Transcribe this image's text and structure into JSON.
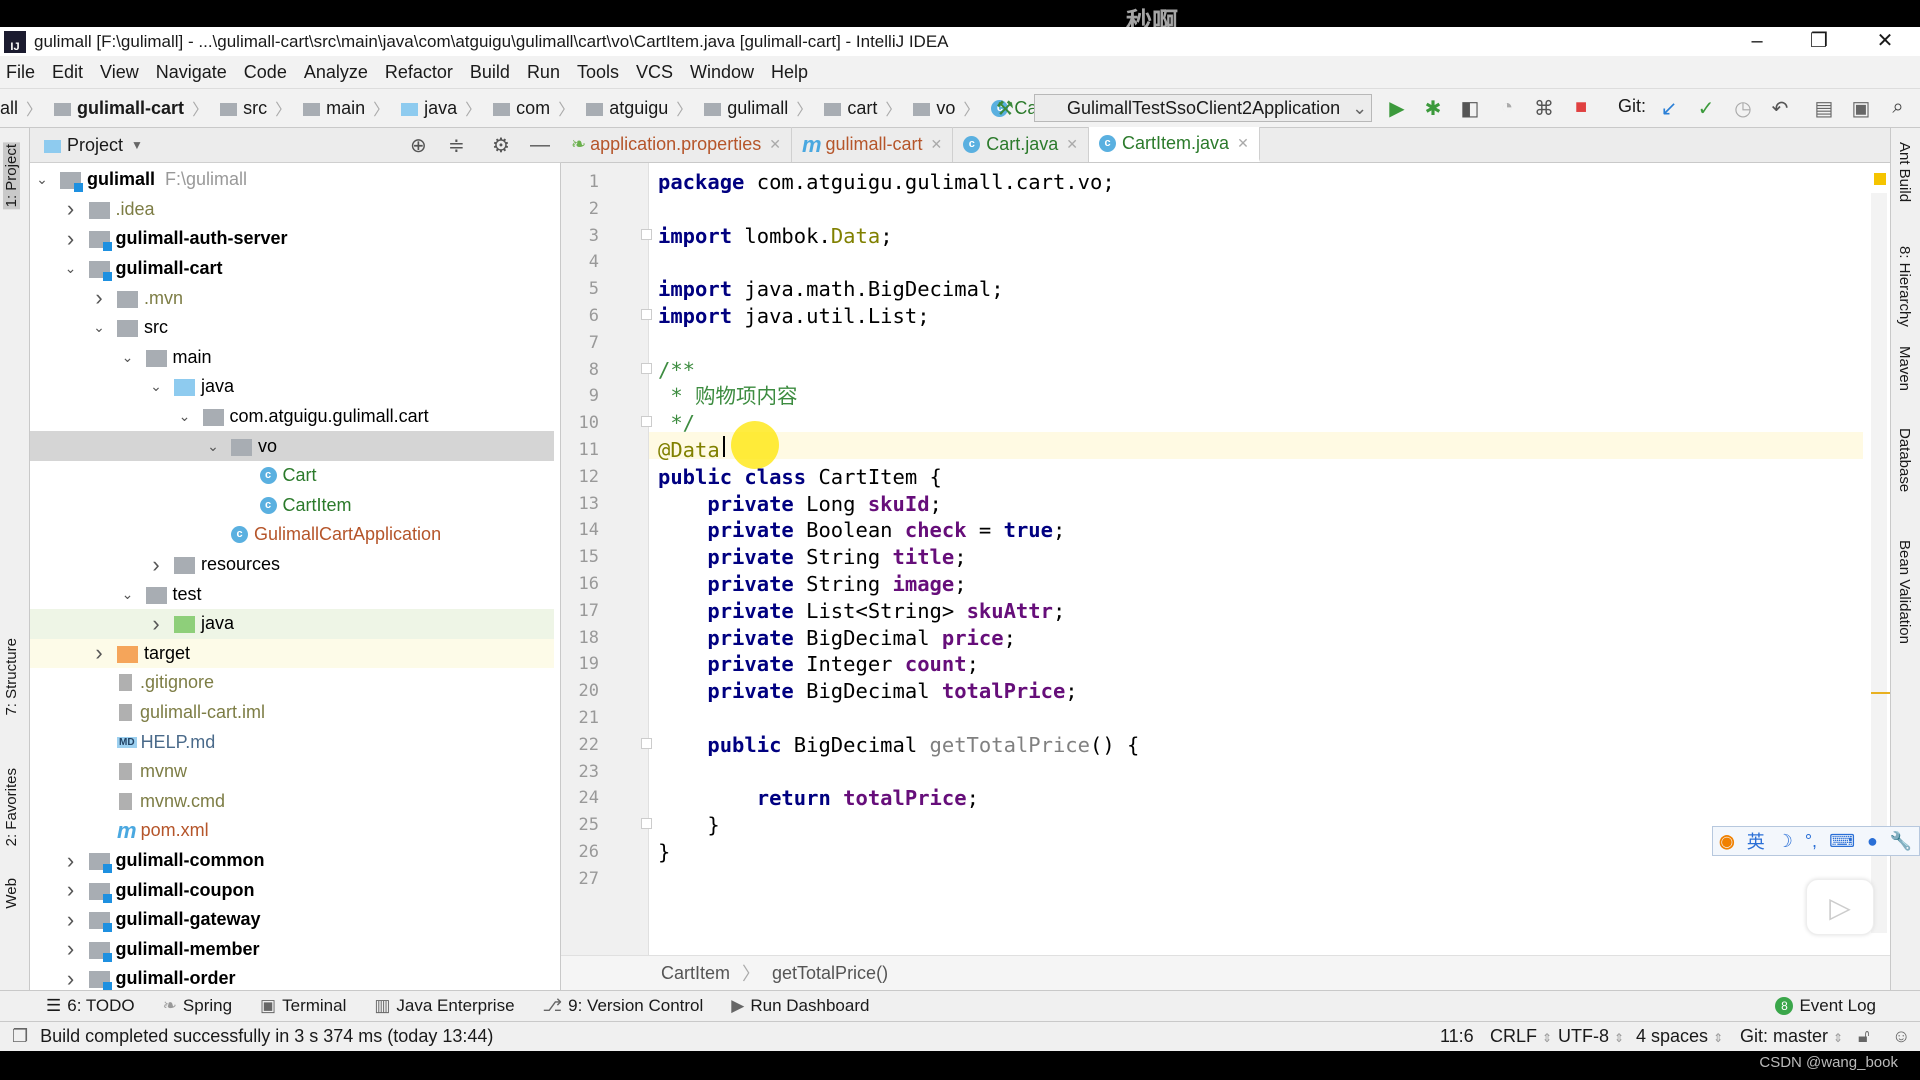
{
  "watermark": "秒啊",
  "title": "gulimall [F:\\gulimall] - ...\\gulimall-cart\\src\\main\\java\\com\\atguigu\\gulimall\\cart\\vo\\CartItem.java [gulimall-cart] - IntelliJ IDEA",
  "menu": [
    "File",
    "Edit",
    "View",
    "Navigate",
    "Code",
    "Analyze",
    "Refactor",
    "Build",
    "Run",
    "Tools",
    "VCS",
    "Window",
    "Help"
  ],
  "nav": [
    "all",
    "gulimall-cart",
    "src",
    "main",
    "java",
    "com",
    "atguigu",
    "gulimall",
    "cart",
    "vo",
    "CartItem"
  ],
  "run_config": "GulimallTestSsoClient2Application",
  "git_label": "Git:",
  "project_header": "Project",
  "left_tabs": [
    "1: Project",
    "7: Structure",
    "2: Favorites",
    "Web"
  ],
  "right_tabs": [
    "Ant Build",
    "8: Hierarchy",
    "Maven",
    "Database",
    "Bean Validation"
  ],
  "tree": [
    {
      "name": "gulimall",
      "extra": "F:\\gulimall",
      "level": 0,
      "chev": "open",
      "icon": "module",
      "bold": true,
      "color": "#000"
    },
    {
      "name": ".idea",
      "level": 1,
      "chev": "closed",
      "icon": "folder",
      "color": "#7d7d45"
    },
    {
      "name": "gulimall-auth-server",
      "level": 1,
      "chev": "closed",
      "icon": "module",
      "bold": true,
      "color": "#000"
    },
    {
      "name": "gulimall-cart",
      "level": 1,
      "chev": "open",
      "icon": "module",
      "bold": true,
      "color": "#000"
    },
    {
      "name": ".mvn",
      "level": 2,
      "chev": "closed",
      "icon": "folder",
      "color": "#7d7d45"
    },
    {
      "name": "src",
      "level": 2,
      "chev": "open",
      "icon": "folder",
      "color": "#000"
    },
    {
      "name": "main",
      "level": 3,
      "chev": "open",
      "icon": "folder",
      "color": "#000"
    },
    {
      "name": "java",
      "level": 4,
      "chev": "open",
      "icon": "folder-blue",
      "color": "#000"
    },
    {
      "name": "com.atguigu.gulimall.cart",
      "level": 5,
      "chev": "open",
      "icon": "package",
      "color": "#000"
    },
    {
      "name": "vo",
      "level": 6,
      "chev": "open",
      "icon": "package",
      "color": "#000",
      "selected": true
    },
    {
      "name": "Cart",
      "level": 7,
      "chev": "none",
      "icon": "class",
      "color": "#2b7a2b"
    },
    {
      "name": "CartItem",
      "level": 7,
      "chev": "none",
      "icon": "class",
      "color": "#2b7a2b"
    },
    {
      "name": "GulimallCartApplication",
      "level": 6,
      "chev": "none",
      "icon": "spring-class",
      "color": "#b5552a"
    },
    {
      "name": "resources",
      "level": 4,
      "chev": "closed",
      "icon": "folder",
      "color": "#000"
    },
    {
      "name": "test",
      "level": 3,
      "chev": "open",
      "icon": "folder",
      "color": "#000"
    },
    {
      "name": "java",
      "level": 4,
      "chev": "closed",
      "icon": "folder-green",
      "color": "#000",
      "tint": "#eef5e6"
    },
    {
      "name": "target",
      "level": 2,
      "chev": "closed",
      "icon": "folder-orange",
      "color": "#000",
      "tint": "#fdfbe8"
    },
    {
      "name": ".gitignore",
      "level": 2,
      "chev": "none",
      "icon": "file",
      "color": "#7d7d45"
    },
    {
      "name": "gulimall-cart.iml",
      "level": 2,
      "chev": "none",
      "icon": "file",
      "color": "#7d7d45"
    },
    {
      "name": "HELP.md",
      "level": 2,
      "chev": "none",
      "icon": "md",
      "color": "#4a6a8a"
    },
    {
      "name": "mvnw",
      "level": 2,
      "chev": "none",
      "icon": "file",
      "color": "#7d7d45"
    },
    {
      "name": "mvnw.cmd",
      "level": 2,
      "chev": "none",
      "icon": "file",
      "color": "#7d7d45"
    },
    {
      "name": "pom.xml",
      "level": 2,
      "chev": "none",
      "icon": "maven",
      "color": "#b5552a"
    },
    {
      "name": "gulimall-common",
      "level": 1,
      "chev": "closed",
      "icon": "module",
      "bold": true,
      "color": "#000"
    },
    {
      "name": "gulimall-coupon",
      "level": 1,
      "chev": "closed",
      "icon": "module",
      "bold": true,
      "color": "#000"
    },
    {
      "name": "gulimall-gateway",
      "level": 1,
      "chev": "closed",
      "icon": "module",
      "bold": true,
      "color": "#000"
    },
    {
      "name": "gulimall-member",
      "level": 1,
      "chev": "closed",
      "icon": "module",
      "bold": true,
      "color": "#000"
    },
    {
      "name": "gulimall-order",
      "level": 1,
      "chev": "closed",
      "icon": "module",
      "bold": true,
      "color": "#000"
    }
  ],
  "tabs": [
    {
      "label": "application.properties",
      "icon": "spring",
      "color": "#b5552a"
    },
    {
      "label": "gulimall-cart",
      "icon": "maven",
      "color": "#b5552a"
    },
    {
      "label": "Cart.java",
      "icon": "class",
      "color": "#2b7a2b"
    },
    {
      "label": "CartItem.java",
      "icon": "class",
      "color": "#2b7a2b",
      "active": true
    }
  ],
  "code": [
    [
      [
        "package ",
        "kw"
      ],
      [
        "com.atguigu.gulimall.cart.vo;",
        "plain"
      ]
    ],
    [],
    [
      [
        "import ",
        "kw"
      ],
      [
        "lombok.",
        "plain"
      ],
      [
        "Data",
        "ann"
      ],
      [
        ";",
        "plain"
      ]
    ],
    [],
    [
      [
        "import ",
        "kw"
      ],
      [
        "java.math.BigDecimal;",
        "plain"
      ]
    ],
    [
      [
        "import ",
        "kw"
      ],
      [
        "java.util.List;",
        "plain"
      ]
    ],
    [],
    [
      [
        "/**",
        "cm"
      ]
    ],
    [
      [
        " * 购物项内容",
        "cm"
      ]
    ],
    [
      [
        " */",
        "cm"
      ]
    ],
    [
      [
        "@Data",
        "ann"
      ]
    ],
    [
      [
        "public class ",
        "kw"
      ],
      [
        "CartItem {",
        "plain"
      ]
    ],
    [
      [
        "    private ",
        "kw"
      ],
      [
        "Long ",
        "plain"
      ],
      [
        "skuId",
        "fld"
      ],
      [
        ";",
        "plain"
      ]
    ],
    [
      [
        "    private ",
        "kw"
      ],
      [
        "Boolean ",
        "plain"
      ],
      [
        "check",
        "fld"
      ],
      [
        " = ",
        "plain"
      ],
      [
        "true",
        "kw"
      ],
      [
        ";",
        "plain"
      ]
    ],
    [
      [
        "    private ",
        "kw"
      ],
      [
        "String ",
        "plain"
      ],
      [
        "title",
        "fld"
      ],
      [
        ";",
        "plain"
      ]
    ],
    [
      [
        "    private ",
        "kw"
      ],
      [
        "String ",
        "plain"
      ],
      [
        "image",
        "fld"
      ],
      [
        ";",
        "plain"
      ]
    ],
    [
      [
        "    private ",
        "kw"
      ],
      [
        "List<String> ",
        "plain"
      ],
      [
        "skuAttr",
        "fld"
      ],
      [
        ";",
        "plain"
      ]
    ],
    [
      [
        "    private ",
        "kw"
      ],
      [
        "BigDecimal ",
        "plain"
      ],
      [
        "price",
        "fld"
      ],
      [
        ";",
        "plain"
      ]
    ],
    [
      [
        "    private ",
        "kw"
      ],
      [
        "Integer ",
        "plain"
      ],
      [
        "count",
        "fld"
      ],
      [
        ";",
        "plain"
      ]
    ],
    [
      [
        "    private ",
        "kw"
      ],
      [
        "BigDecimal ",
        "plain"
      ],
      [
        "totalPrice",
        "fld"
      ],
      [
        ";",
        "plain"
      ]
    ],
    [],
    [
      [
        "    public ",
        "kw"
      ],
      [
        "BigDecimal ",
        "plain"
      ],
      [
        "getTotalPrice",
        "unused"
      ],
      [
        "() {",
        "plain"
      ]
    ],
    [],
    [
      [
        "        return ",
        "kw"
      ],
      [
        "totalPrice",
        "fld"
      ],
      [
        ";",
        "plain"
      ]
    ],
    [
      [
        "    }",
        "plain"
      ]
    ],
    [
      [
        "}",
        "plain"
      ]
    ],
    []
  ],
  "breadcrumb": [
    "CartItem",
    "getTotalPrice()"
  ],
  "toolwindows": [
    "6: TODO",
    "Spring",
    "Terminal",
    "Java Enterprise",
    "9: Version Control",
    "Run Dashboard"
  ],
  "event_log": {
    "label": "Event Log",
    "count": "8"
  },
  "status": {
    "message": "Build completed successfully in 3 s 374 ms (today 13:44)",
    "position": "11:6",
    "line_sep": "CRLF",
    "encoding": "UTF-8",
    "indent": "4 spaces",
    "branch": "Git: master"
  },
  "ime": {
    "lang": "英"
  },
  "credit": "CSDN @wang_book"
}
